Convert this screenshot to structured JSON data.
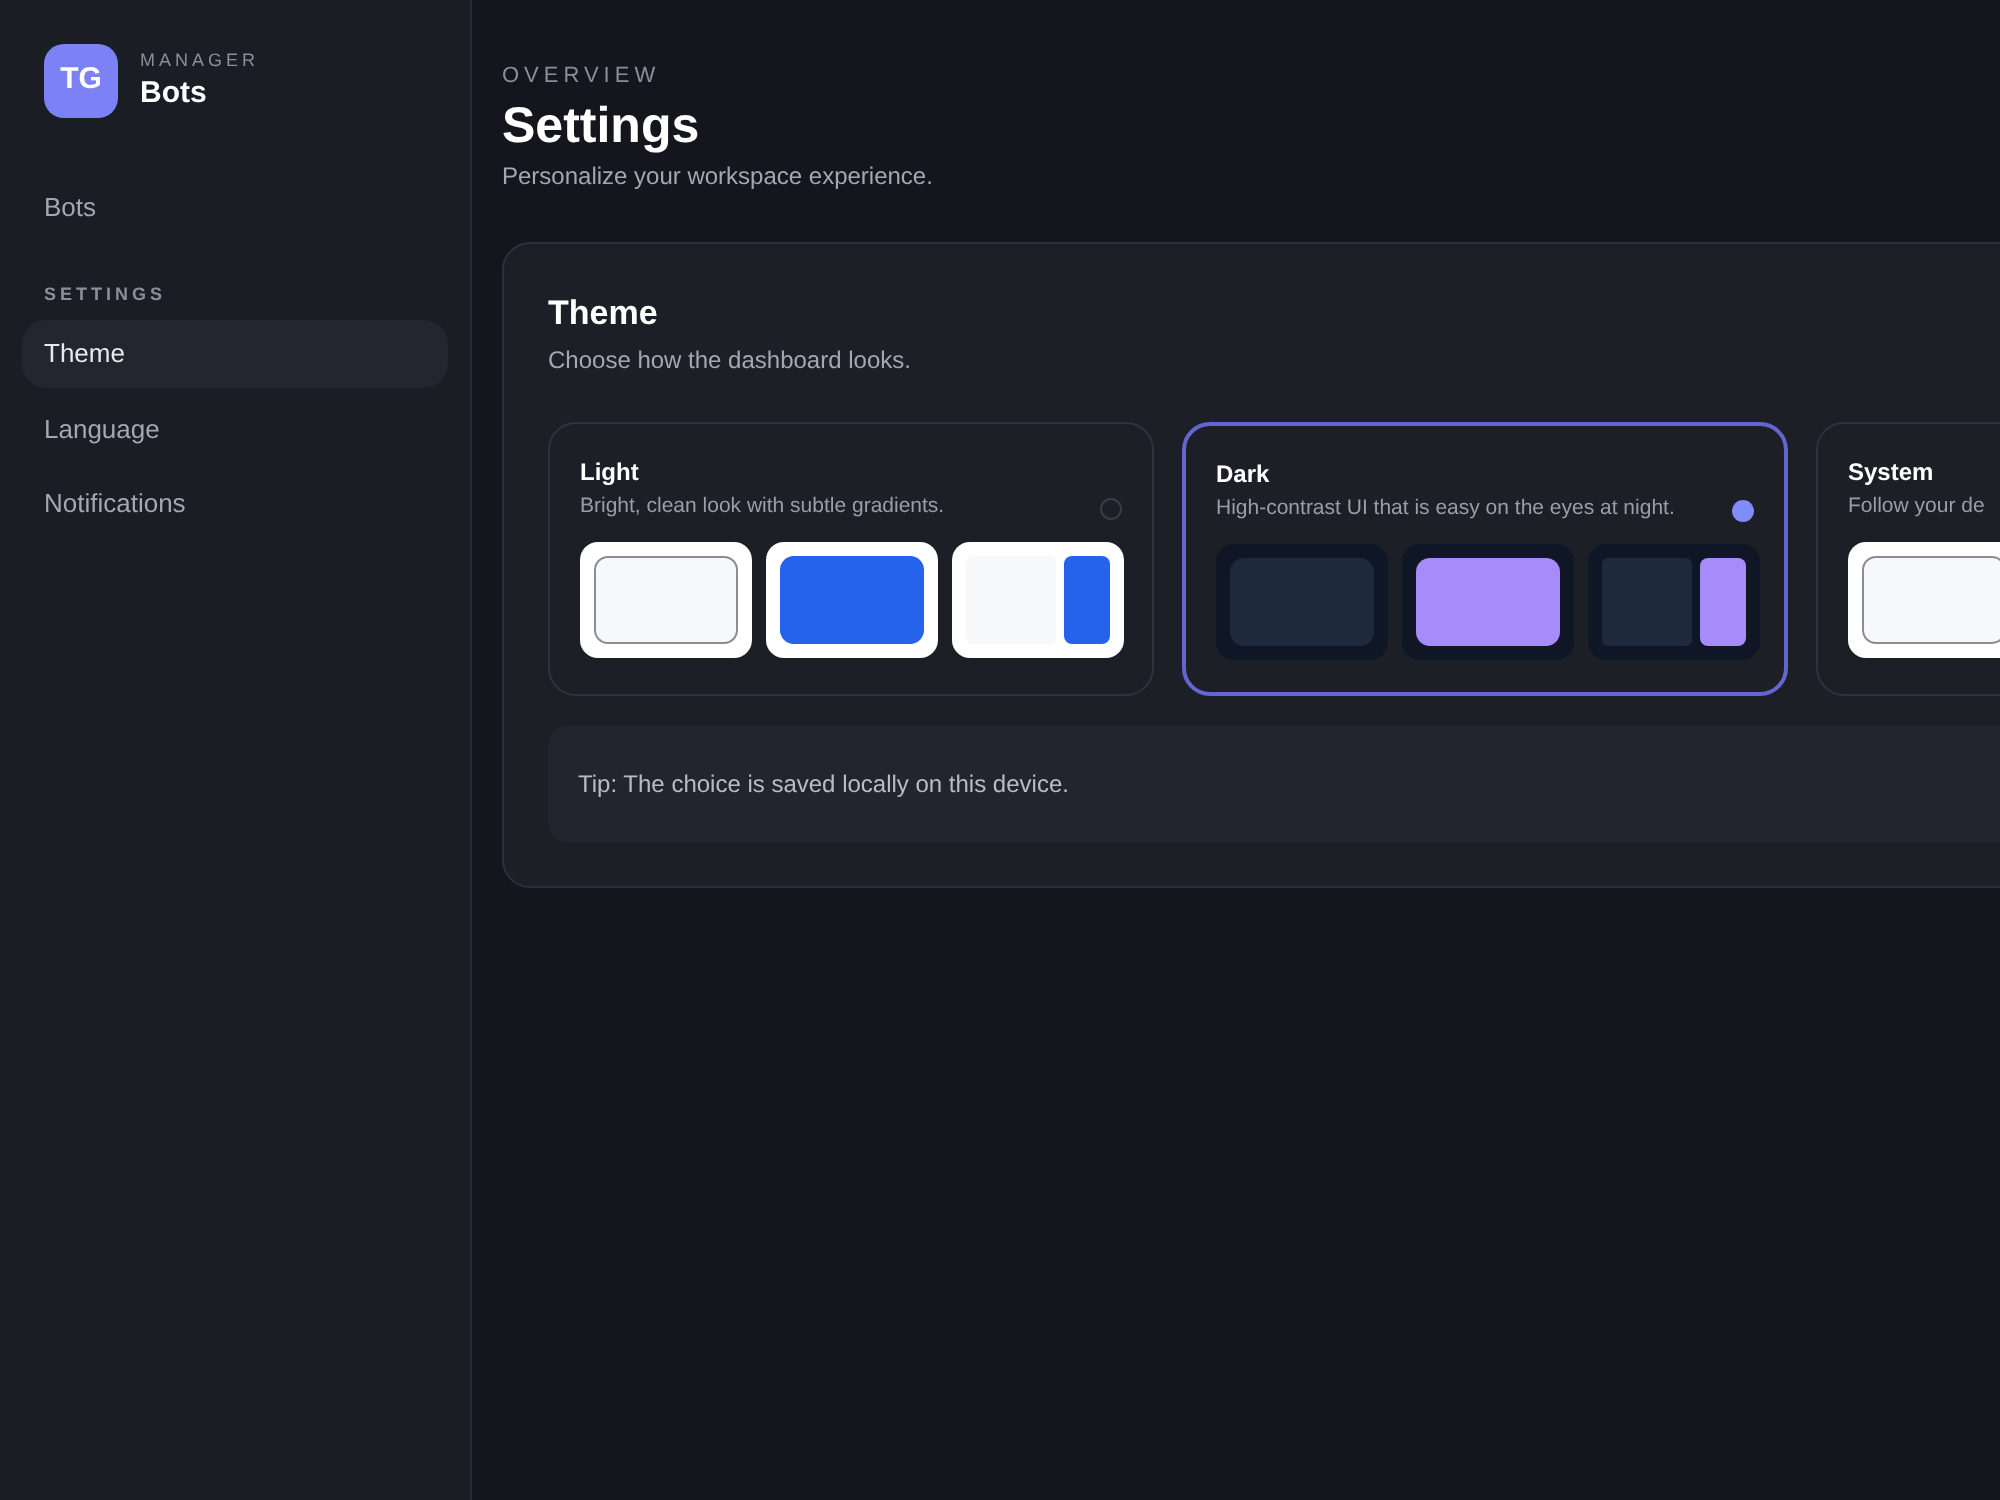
{
  "brand": {
    "logo": "TG",
    "caption": "MANAGER",
    "title": "Bots"
  },
  "nav": [
    {
      "label": "Bots",
      "selected": false
    }
  ],
  "settings_section": {
    "heading": "SETTINGS",
    "items": [
      {
        "label": "Theme",
        "selected": true
      },
      {
        "label": "Language",
        "selected": false
      },
      {
        "label": "Notifications",
        "selected": false
      }
    ]
  },
  "header": {
    "eyebrow": "OVERVIEW",
    "title": "Settings",
    "subtitle": "Personalize your workspace experience."
  },
  "theme_card": {
    "title": "Theme",
    "subtitle": "Choose how the dashboard looks.",
    "options": [
      {
        "name": "Light",
        "description": "Bright, clean look with subtle gradients.",
        "kind": "light",
        "selected": false,
        "radio": {
          "selected": false
        },
        "previews": [
          {
            "kind": "outline"
          },
          {
            "kind": "fill"
          },
          {
            "kind": "split"
          }
        ]
      },
      {
        "name": "Dark",
        "description": "High-contrast UI that is easy on the eyes at night.",
        "kind": "dark",
        "selected": true,
        "radio": {
          "selected": true
        },
        "previews": [
          {
            "kind": "outline"
          },
          {
            "kind": "fill"
          },
          {
            "kind": "split"
          }
        ]
      },
      {
        "name": "System",
        "description": "Follow your de",
        "kind": "light",
        "selected": false,
        "previews": [
          {
            "kind": "outline"
          }
        ]
      }
    ],
    "tip": "Tip: The choice is saved locally on this device."
  }
}
